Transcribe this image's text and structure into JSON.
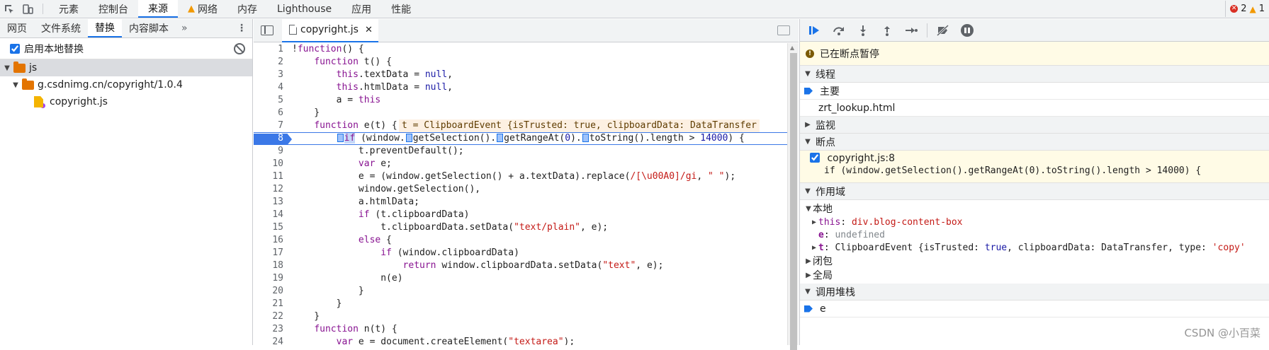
{
  "top_tabs": [
    "元素",
    "控制台",
    "来源",
    "网络",
    "内存",
    "Lighthouse",
    "应用",
    "性能"
  ],
  "top_active_index": 2,
  "counts": {
    "errors": "2",
    "warnings": "1"
  },
  "left_tabs": [
    "网页",
    "文件系统",
    "替换",
    "内容脚本"
  ],
  "left_active_index": 2,
  "override_label": "启用本地替换",
  "tree": {
    "root": "js",
    "domain": "g.csdnimg.cn/copyright/1.0.4",
    "file": "copyright.js"
  },
  "editor_tab": "copyright.js",
  "paused_line": 8,
  "inline_value": "t = ClipboardEvent {isTrusted: true, clipboardData: DataTransfer",
  "code_lines": [
    {
      "n": "1",
      "html": "!<span class=\"kw\">function</span>() {"
    },
    {
      "n": "2",
      "html": "    <span class=\"kw\">function</span> t() {"
    },
    {
      "n": "3",
      "html": "        <span class=\"kw\">this</span>.textData = <span class=\"kwb\">null</span>,"
    },
    {
      "n": "4",
      "html": "        <span class=\"kw\">this</span>.htmlData = <span class=\"kwb\">null</span>,"
    },
    {
      "n": "5",
      "html": "        a = <span class=\"kw\">this</span>"
    },
    {
      "n": "6",
      "html": "    }"
    },
    {
      "n": "7",
      "html": "    <span class=\"kw\">function</span> e(t) {"
    },
    {
      "n": "8",
      "html": "        <span class=\"stop-mark\"></span><span class=\"kw cur-kw\">if</span> (window.<span class=\"stop-mark\"></span>getSelection().<span class=\"stop-mark\"></span>getRangeAt(<span class=\"num\">0</span>).<span class=\"stop-mark\"></span>toString().length &gt; <span class=\"num\">14000</span>) {"
    },
    {
      "n": "9",
      "html": "            t.preventDefault();"
    },
    {
      "n": "10",
      "html": "            <span class=\"kw\">var</span> e;"
    },
    {
      "n": "11",
      "html": "            e = (window.getSelection() + a.textData).replace(<span class=\"str\">/[\\u00A0]/gi</span>, <span class=\"str\">\" \"</span>);"
    },
    {
      "n": "12",
      "html": "            window.getSelection(),"
    },
    {
      "n": "13",
      "html": "            a.htmlData;"
    },
    {
      "n": "14",
      "html": "            <span class=\"kw\">if</span> (t.clipboardData)"
    },
    {
      "n": "15",
      "html": "                t.clipboardData.setData(<span class=\"str\">\"text/plain\"</span>, e);"
    },
    {
      "n": "16",
      "html": "            <span class=\"kw\">else</span> {"
    },
    {
      "n": "17",
      "html": "                <span class=\"kw\">if</span> (window.clipboardData)"
    },
    {
      "n": "18",
      "html": "                    <span class=\"kw\">return</span> window.clipboardData.setData(<span class=\"str\">\"text\"</span>, e);"
    },
    {
      "n": "19",
      "html": "                n(e)"
    },
    {
      "n": "20",
      "html": "            }"
    },
    {
      "n": "21",
      "html": "        }"
    },
    {
      "n": "22",
      "html": "    }"
    },
    {
      "n": "23",
      "html": "    <span class=\"kw\">function</span> n(t) {"
    },
    {
      "n": "24",
      "html": "        <span class=\"kw\">var</span> e = document.createElement(<span class=\"str\">\"textarea\"</span>);"
    }
  ],
  "debugger": {
    "paused_text": "已在断点暂停",
    "threads_header": "线程",
    "threads": [
      "主要",
      "zrt_lookup.html"
    ],
    "watch_header": "监视",
    "breakpoints_header": "断点",
    "breakpoint_file": "copyright.js:8",
    "breakpoint_code": "if (window.getSelection().getRangeAt(0).toString().length > 14000) {",
    "scope_header": "作用域",
    "scope_local": "本地",
    "scope_vars": [
      {
        "name": "this",
        "value": "div.blog-content-box"
      },
      {
        "name": "e",
        "value": "undefined"
      },
      {
        "name": "t",
        "value": "ClipboardEvent {isTrusted: true, clipboardData: DataTransfer, type: 'copy'"
      }
    ],
    "scope_closure": "闭包",
    "scope_global": "全局",
    "callstack_header": "调用堆栈",
    "callstack_first": "e"
  },
  "watermark": "CSDN @小百菜",
  "colors": {
    "accent": "#1a73e8",
    "paused_bg": "#fffbe6",
    "keyword": "#881391",
    "string": "#c41a16"
  }
}
